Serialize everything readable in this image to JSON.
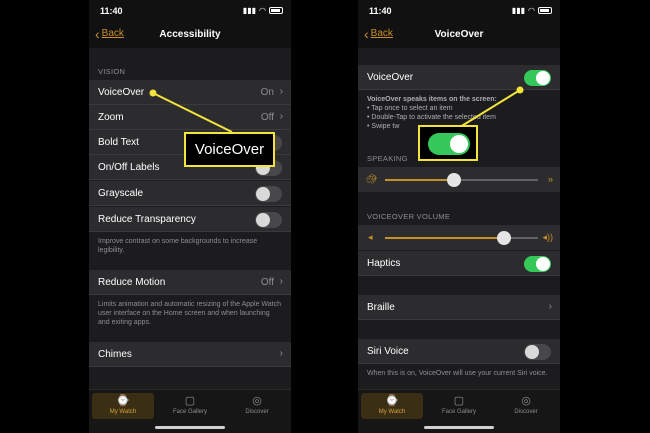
{
  "left": {
    "status": {
      "time": "11:40"
    },
    "nav": {
      "back_label": "Back",
      "title": "Accessibility"
    },
    "vision_header": "VISION",
    "rows": [
      {
        "label": "VoiceOver",
        "value": "On"
      },
      {
        "label": "Zoom",
        "value": "Off"
      },
      {
        "label": "Bold Text"
      },
      {
        "label": "On/Off Labels"
      },
      {
        "label": "Grayscale"
      },
      {
        "label": "Reduce Transparency"
      }
    ],
    "transparency_note": "Improve contrast on some backgrounds to increase legibility.",
    "reduce_motion": {
      "label": "Reduce Motion",
      "value": "Off"
    },
    "motion_note": "Limits animation and automatic resizing of the Apple Watch user interface on the Home screen and when launching and exiting apps.",
    "chimes": {
      "label": "Chimes"
    },
    "tabs": [
      {
        "label": "My Watch"
      },
      {
        "label": "Face Gallery"
      },
      {
        "label": "Discover"
      }
    ]
  },
  "right": {
    "status": {
      "time": "11:40"
    },
    "nav": {
      "back_label": "Back",
      "title": "VoiceOver"
    },
    "voiceover_row": {
      "label": "VoiceOver"
    },
    "voiceover_desc_title": "VoiceOver speaks items on the screen:",
    "voiceover_bullets": [
      "• Tap once to select an item",
      "• Double-Tap to activate the selected item",
      "• Swipe tw"
    ],
    "speaking_header": "SPEAKING",
    "speaking_rate": 0.45,
    "volume_header": "VOICEOVER VOLUME",
    "volume_level": 0.78,
    "haptics": {
      "label": "Haptics"
    },
    "braille": {
      "label": "Braille"
    },
    "siri_voice": {
      "label": "Siri Voice"
    },
    "siri_note": "When this is on, VoiceOver will use your current Siri voice.",
    "tabs": [
      {
        "label": "My Watch"
      },
      {
        "label": "Face Gallery"
      },
      {
        "label": "Discover"
      }
    ]
  },
  "callouts": {
    "left_text": "VoiceOver"
  },
  "colors": {
    "accent": "#c98f2b",
    "toggle_on": "#34c759",
    "callout_border": "#f2e43c"
  },
  "icons": {
    "tab_my_watch": "watch-icon",
    "tab_face_gallery": "watch-face-icon",
    "tab_discover": "compass-icon"
  }
}
